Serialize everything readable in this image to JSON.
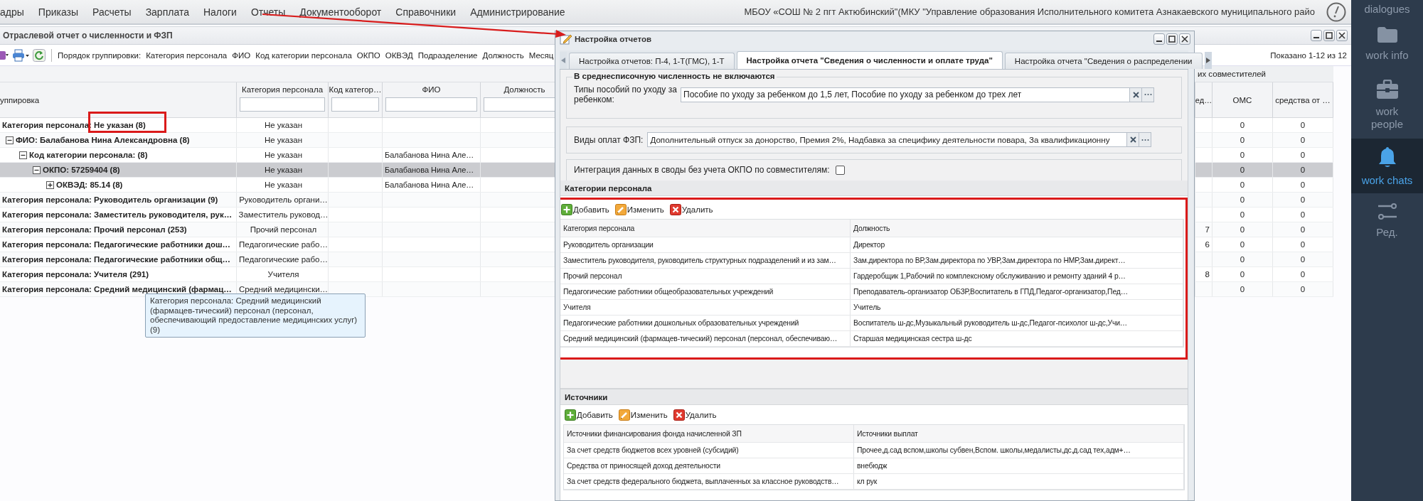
{
  "menu": {
    "items": [
      "адры",
      "Приказы",
      "Расчеты",
      "Зарплата",
      "Налоги",
      "Отчеты",
      "Документооборот",
      "Справочники",
      "Администрирование"
    ],
    "organization": "МБОУ «СОШ № 2 пгт Актюбинский\"(МКУ \"Управление образования Исполнительного комитета Азнакаевского муниципального райо"
  },
  "window": {
    "title": "Отраслевой отчет о численности и ФЗП"
  },
  "toolbar": {
    "grouping_label": "Порядок группировки:",
    "grouping_items": [
      "Категория персонала",
      "ФИО",
      "Код категории персонала",
      "ОКПО",
      "ОКВЭД",
      "Подразделение",
      "Должность",
      "Месяц"
    ],
    "paging": "Показано 1-12 из 12"
  },
  "grid": {
    "group_header": "их совместителей",
    "columns": [
      {
        "label": "уппировка",
        "filter": false
      },
      {
        "label": "Категория персонала",
        "filter": true
      },
      {
        "label": "Код категор…",
        "filter": true
      },
      {
        "label": "ФИО",
        "filter": true
      },
      {
        "label": "Должность",
        "filter": true
      },
      {
        "label": "ед…",
        "filter": false
      },
      {
        "label": "ОМС",
        "filter": false
      },
      {
        "label": "средства от …",
        "filter": false
      }
    ],
    "rows": [
      {
        "label": "Категория персонала: Не указан (8)",
        "category": "Не указан",
        "oms": "0",
        "funds": "0",
        "selected": false,
        "children": [
          {
            "label": "ФИО: Балабанова Нина Александровна (8)",
            "category": "Не указан",
            "oms": "0",
            "funds": "0",
            "selected": false,
            "expanded": true,
            "children": [
              {
                "label": "Код категории персонала: (8)",
                "category": "Не указан",
                "fio": "Балабанова Нина Але…",
                "oms": "0",
                "funds": "0",
                "selected": false,
                "expanded": true,
                "children": [
                  {
                    "label": "ОКПО: 57259404 (8)",
                    "category": "Не указан",
                    "fio": "Балабанова Нина Але…",
                    "oms": "0",
                    "funds": "0",
                    "selected": true,
                    "expanded": true,
                    "children": [
                      {
                        "label": "ОКВЭД: 85.14 (8)",
                        "category": "Не указан",
                        "fio": "Балабанова Нина Але…",
                        "oms": "0",
                        "funds": "0",
                        "selected": false,
                        "expanded": false
                      }
                    ]
                  }
                ]
              }
            ]
          }
        ]
      },
      {
        "label": "Категория персонала: Руководитель организации (9)",
        "category": "Руководитель органи…",
        "oms": "0",
        "funds": "0",
        "selected": false
      },
      {
        "label": "Категория персонала: Заместитель руководителя, рук…",
        "category": "Заместитель руковод…",
        "oms": "0",
        "funds": "0",
        "selected": false
      },
      {
        "label": "Категория персонала: Прочий персонал (253)",
        "category": "Прочий персонал",
        "column_6": "7",
        "oms": "0",
        "funds": "0",
        "selected": false
      },
      {
        "label": "Категория персонала: Педагогические работники дош…",
        "category": "Педагогические рабо…",
        "column_6": "6",
        "oms": "0",
        "funds": "0",
        "selected": false
      },
      {
        "label": "Категория персонала: Педагогические работники общ…",
        "category": "Педагогические рабо…",
        "oms": "0",
        "funds": "0",
        "selected": false
      },
      {
        "label": "Категория персонала: Учителя (291)",
        "category": "Учителя",
        "column_6": "8",
        "oms": "0",
        "funds": "0",
        "selected": false
      },
      {
        "label": "Категория персонала: Средний медицинский (фармац…",
        "category": "Средний медицински…",
        "oms": "0",
        "funds": "0",
        "selected": false
      }
    ],
    "tooltip": "Категория персонала: Средний медицинский (фармацев-тический) персонал (персонал, обеспечивающий предоставление медицинских услуг) (9)"
  },
  "dialog": {
    "title": "Настройка отчетов",
    "tabs": [
      {
        "label": "Настройка отчетов: П-4, 1-Т(ГМС), 1-Т",
        "selected": false
      },
      {
        "label": "Настройка отчета \"Сведения о численности и оплате труда\"",
        "selected": true
      },
      {
        "label": "Настройка отчета \"Сведения о распределении",
        "selected": false
      }
    ],
    "excluded": {
      "legend": "В среднесписочную численность не включаются",
      "label": "Типы пособий по уходу за ребенком:",
      "value": "Пособие по уходу за ребенком до 1,5 лет, Пособие по уходу за ребенком до трех лет"
    },
    "payments": {
      "label": "Виды оплат ФЗП:",
      "value": "Дополнительный отпуск за донорство, Премия 2%, Надбавка за специфику деятельности повара, За квалификационну"
    },
    "integration": {
      "label": "Интеграция данных в своды без учета ОКПО по совместителям:",
      "checked": false
    },
    "panels": [
      {
        "title": "Категории персонала",
        "highlighted": true,
        "buttons": [
          {
            "label": "Добавить",
            "kind": "add"
          },
          {
            "label": "Изменить",
            "kind": "edit"
          },
          {
            "label": "Удалить",
            "kind": "delete"
          }
        ],
        "columns": [
          "Категория персонала",
          "Должность"
        ],
        "rows": [
          [
            "Руководитель организации",
            "Директор"
          ],
          [
            "Заместитель руководителя, руководитель структурных подразделений и из зам…",
            "Зам.директора по ВР,Зам.директора по УВР,Зам.директора по НМР,Зам.директ…"
          ],
          [
            "Прочий персонал",
            "Гардеробщик 1,Рабочий по комплексному обслуживанию и ремонту зданий 4 р…"
          ],
          [
            "Педагогические работники общеобразовательных учреждений",
            "Преподаватель-организатор ОБЗР,Воспитатель в ГПД,Педагог-организатор,Пед…"
          ],
          [
            "Учителя",
            "Учитель"
          ],
          [
            "Педагогические работники дошкольных образовательных учреждений",
            "Воспитатель ш-дс,Музыкальный руководитель ш-дс,Педагог-психолог ш-дс,Учи…"
          ],
          [
            "Средний медицинский (фармацев-тический) персонал (персонал, обеспечиваю…",
            "Старшая медицинская сестра ш-дс"
          ]
        ]
      },
      {
        "title": "Источники",
        "highlighted": false,
        "buttons": [
          {
            "label": "Добавить",
            "kind": "add"
          },
          {
            "label": "Изменить",
            "kind": "edit"
          },
          {
            "label": "Удалить",
            "kind": "delete"
          }
        ],
        "columns": [
          "Источники финансирования фонда начисленной ЗП",
          "Источники выплат"
        ],
        "rows": [
          [
            "За счет средств бюджетов всех уровней (субсидий)",
            "Прочее,д.сад вспом,школы субвен,Вспом. школы,медалисты,дс,д.сад тех,адм+…"
          ],
          [
            "Средства от приносящей доход деятельности",
            "внебюдж"
          ],
          [
            "За счет средств федерального бюджета, выплаченных за классное руководств…",
            "кл рук"
          ]
        ]
      }
    ]
  },
  "sidebar": {
    "items": [
      {
        "label": "dialogues",
        "selected": false
      },
      {
        "label": "work info",
        "selected": false
      },
      {
        "label": "work people",
        "selected": false
      },
      {
        "label": "work chats",
        "selected": true
      },
      {
        "label": "Ред.",
        "selected": false
      }
    ]
  }
}
